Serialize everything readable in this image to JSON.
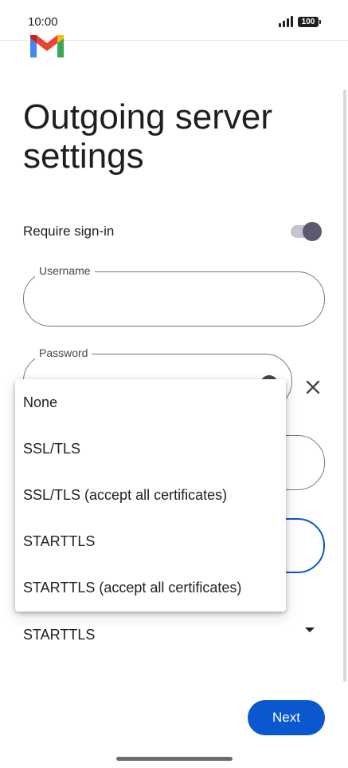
{
  "status_bar": {
    "time": "10:00",
    "battery": "100"
  },
  "page": {
    "title": "Outgoing server settings"
  },
  "require_signin": {
    "label": "Require sign-in",
    "enabled": true
  },
  "fields": {
    "username": {
      "label": "Username",
      "value": ""
    },
    "password": {
      "label": "Password",
      "value": ""
    }
  },
  "security_type": {
    "selected": "STARTTLS",
    "options": [
      "None",
      "SSL/TLS",
      "SSL/TLS (accept all certificates)",
      "STARTTLS",
      "STARTTLS (accept all certificates)"
    ]
  },
  "actions": {
    "next_label": "Next"
  },
  "colors": {
    "accent": "#0b57d0",
    "toggle_thumb": "#5e5870",
    "toggle_track": "#c8c4cf",
    "outline": "#777777"
  },
  "icons": [
    "gmail-logo",
    "visibility-icon",
    "close-icon",
    "chevron-down-icon"
  ]
}
